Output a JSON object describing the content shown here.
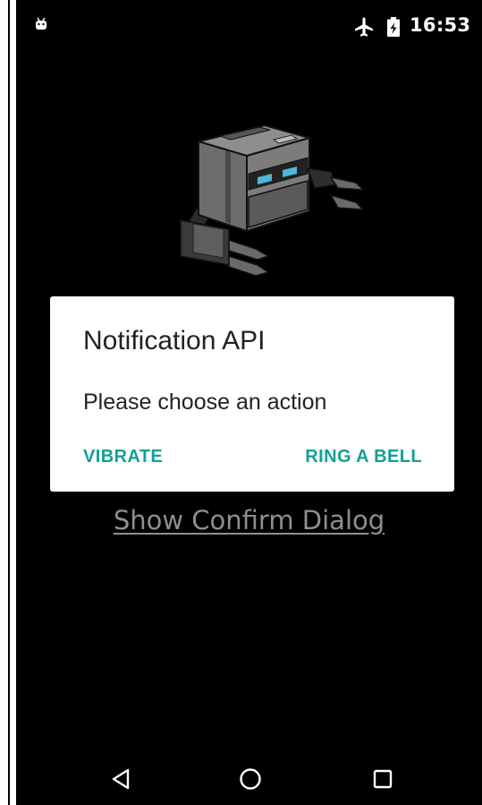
{
  "status_bar": {
    "time": "16:53",
    "icons": [
      "android-debug-icon",
      "airplane-mode-icon",
      "battery-charging-icon"
    ]
  },
  "background": {
    "illustration": "robot-icon",
    "confirm_link": "Show Confirm Dialog"
  },
  "dialog": {
    "title": "Notification API",
    "message": "Please choose an action",
    "buttons": {
      "negative": "VIBRATE",
      "positive": "RING A BELL"
    }
  },
  "nav_bar": {
    "icons": [
      "back-icon",
      "home-icon",
      "recents-icon"
    ]
  },
  "colors": {
    "accent": "#139f96",
    "screen_background": "#000000",
    "dialog_background": "#ffffff",
    "muted_link": "#8f8f8f"
  }
}
